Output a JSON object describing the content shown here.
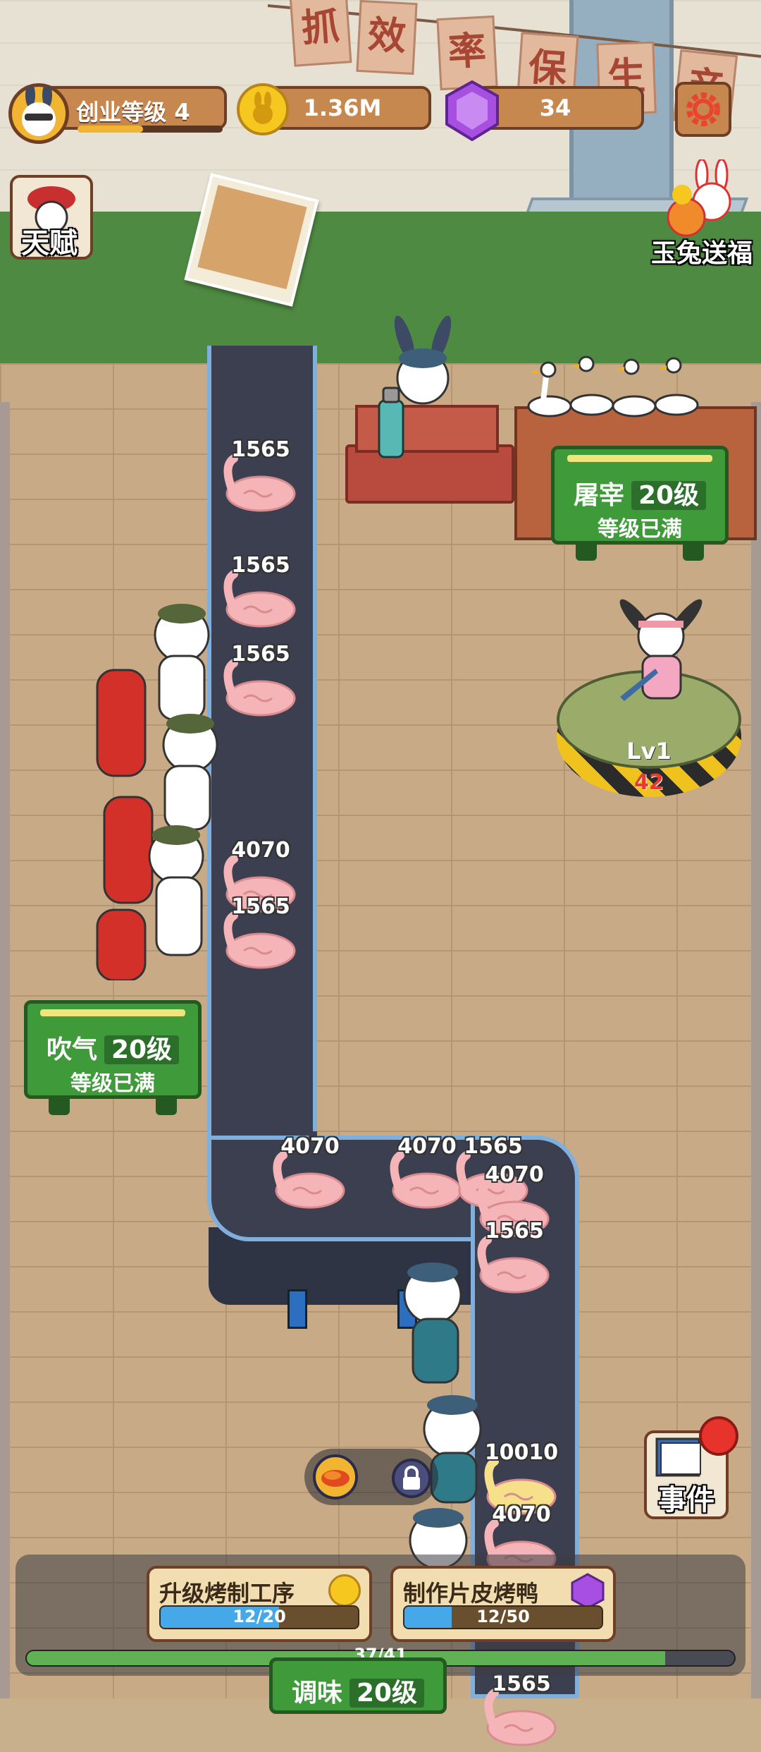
{
  "hud": {
    "level_label": "创业等级 4",
    "level_progress": 0.45,
    "coins": "1.36M",
    "gems": "34"
  },
  "banner": [
    "抓",
    "效",
    "率",
    "保",
    "生",
    "产"
  ],
  "side_buttons": {
    "talent": "天赋",
    "rabbit_gift": "玉兔送福",
    "events": "事件"
  },
  "stations": {
    "slaughter": {
      "name": "屠宰",
      "level": "20级",
      "status": "等级已满"
    },
    "inflate": {
      "name": "吹气",
      "level": "20级",
      "status": "等级已满"
    },
    "season": {
      "name": "调味",
      "level": "20级"
    },
    "worker_level": "Lv1",
    "worker_count": "42"
  },
  "ducks": [
    "1565",
    "1565",
    "1565",
    "4070",
    "1565",
    "4070",
    "4070",
    "1565",
    "4070",
    "1565",
    "10010",
    "4070",
    "1565"
  ],
  "actions": {
    "upgrade": {
      "label": "升级烤制工序",
      "progress_text": "12/20",
      "progress": 0.6
    },
    "make": {
      "label": "制作片皮烤鸭",
      "progress_text": "12/50",
      "progress": 0.24
    }
  },
  "main_progress": {
    "text": "37/41",
    "value": 0.902
  },
  "colors": {
    "accent": "#c6884e",
    "panel_green": "#3f9a3a",
    "belt_blue": "#7fb0dd",
    "progress_blue": "#46a8e8",
    "gem_purple": "#a64fe0",
    "coin_yellow": "#f6c71e"
  }
}
